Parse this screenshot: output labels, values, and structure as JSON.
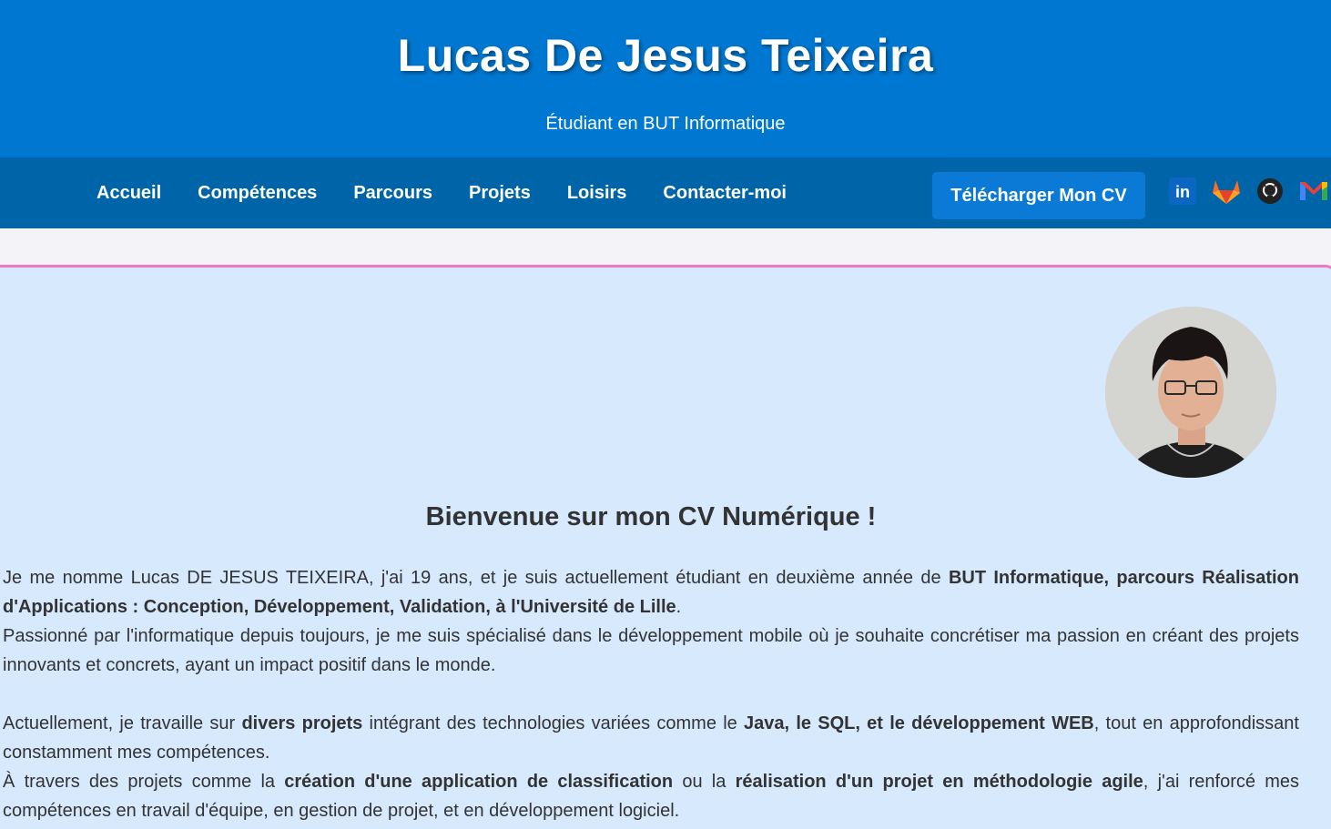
{
  "header": {
    "name": "Lucas De Jesus Teixeira",
    "subtitle": "Étudiant en BUT Informatique"
  },
  "nav": {
    "items": [
      {
        "label": "Accueil"
      },
      {
        "label": "Compétences"
      },
      {
        "label": "Parcours"
      },
      {
        "label": "Projets"
      },
      {
        "label": "Loisirs"
      },
      {
        "label": "Contacter-moi"
      }
    ],
    "cv_button": "Télécharger Mon CV",
    "socials": [
      {
        "icon": "linkedin-icon",
        "text": "in"
      },
      {
        "icon": "gitlab-icon"
      },
      {
        "icon": "github-icon"
      },
      {
        "icon": "gmail-icon"
      }
    ]
  },
  "colors": {
    "header_bg": "#0078d2",
    "nav_bg": "#0064a8",
    "button_bg": "#0a7ad6",
    "content_bg": "#d6e9fd",
    "accent_border": "#f177c4"
  },
  "main": {
    "welcome": "Bienvenue sur mon CV Numérique !",
    "p1": {
      "t1": "Je me nomme Lucas DE JESUS TEIXEIRA, j'ai 19 ans, et je suis actuellement étudiant en deuxième année de ",
      "b1": "BUT Informatique, parcours Réalisation d'Applications : Conception, Développement, Validation, à l'Université de Lille",
      "t2": "."
    },
    "p2": "Passionné par l'informatique depuis toujours, je me suis spécialisé dans le développement mobile où je souhaite concrétiser ma passion en créant des projets innovants et concrets, ayant un impact positif dans le monde.",
    "p3": {
      "t1": "Actuellement, je travaille sur ",
      "b1": "divers projets",
      "t2": " intégrant des technologies variées comme le ",
      "b2": "Java, le SQL, et le développement WEB",
      "t3": ", tout en approfondissant constamment mes compétences."
    },
    "p4": {
      "t1": "À travers des projets comme la ",
      "b1": "création d'une application de classification",
      "t2": " ou la ",
      "b2": "réalisation d'un projet en méthodologie agile",
      "t3": ", j'ai renforcé mes compétences en travail d'équipe, en gestion de projet, et en développement logiciel."
    }
  }
}
